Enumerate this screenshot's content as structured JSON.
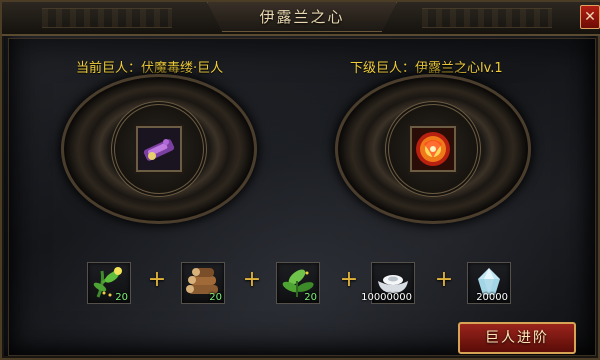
{
  "window": {
    "title": "伊露兰之心",
    "close_label": "✕"
  },
  "current_giant": {
    "label": "当前巨人：伏魔毒缕·巨人",
    "icon": "purple-weapon-icon"
  },
  "next_giant": {
    "label": "下级巨人：伊露兰之心lv.1",
    "icon": "flaming-orb-icon"
  },
  "materials": [
    {
      "icon": "green-herb-flower-icon",
      "count": "20"
    },
    {
      "icon": "wood-logs-icon",
      "count": "20"
    },
    {
      "icon": "green-leaves-icon",
      "count": "20"
    },
    {
      "icon": "silver-ingot-icon",
      "count": "10000000"
    },
    {
      "icon": "crystal-icon",
      "count": "20000"
    }
  ],
  "plus_symbol": "+",
  "advance_button": {
    "label": "巨人进阶"
  },
  "colors": {
    "label_gold": "#f2cf3a",
    "count_green": "#7ef07a",
    "accent_red": "#9a241c"
  }
}
